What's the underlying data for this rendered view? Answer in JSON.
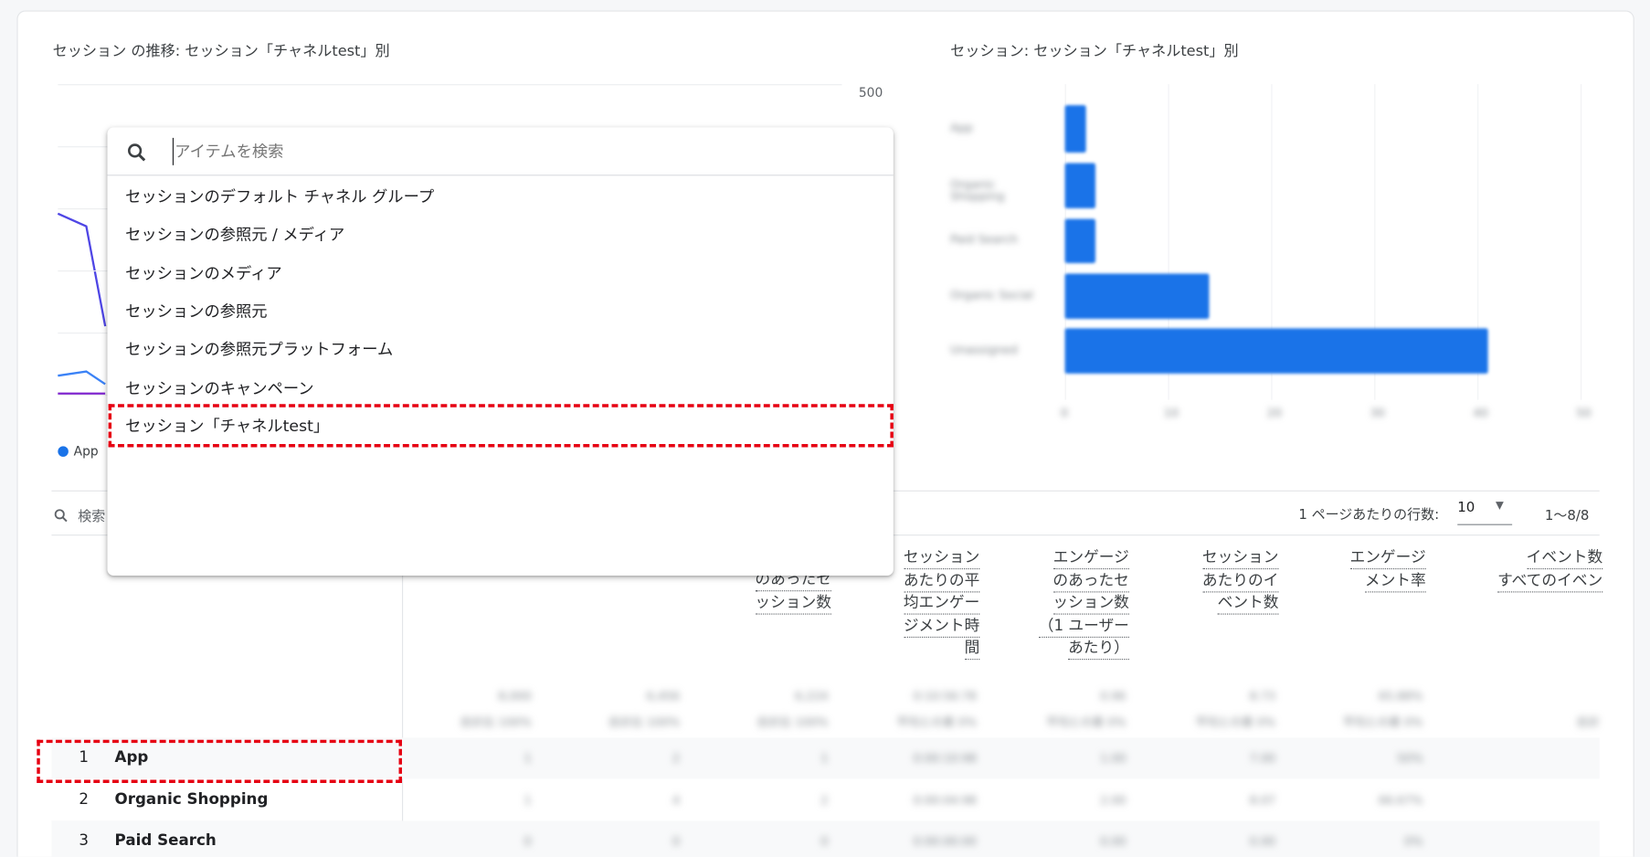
{
  "line_chart": {
    "title": "セッション の推移: セッション「チャネルtest」別",
    "y_tick_top": "500",
    "legend": [
      {
        "label": "App",
        "color": "#1a73e8"
      }
    ],
    "line_colors": [
      "#4f46e5",
      "#3b82f6",
      "#7e22ce"
    ]
  },
  "bar_chart": {
    "title": "セッション: セッション「チャネルtest」別",
    "bar_color": "#1a73e8"
  },
  "chart_data": {
    "type": "bar",
    "orientation": "horizontal",
    "title": "セッション: セッション「チャネルtest」別",
    "categories": [
      "App",
      "Organic Shopping",
      "Paid Search",
      "Organic Social",
      "Unassigned"
    ],
    "values": [
      2,
      3,
      3,
      14,
      41
    ],
    "x_ticks": [
      "0",
      "10",
      "20",
      "30",
      "40",
      "50"
    ],
    "xlim": [
      0,
      50
    ],
    "grid": true,
    "note_blurred": true
  },
  "dropdown": {
    "search_placeholder": "アイテムを検索",
    "search_icon": "search-icon",
    "items": [
      "セッションのデフォルト チャネル グループ",
      "セッションの参照元 / メディア",
      "セッションのメディア",
      "セッションの参照元",
      "セッションの参照元プラットフォーム",
      "セッションのキャンペーン",
      "セッション「チャネルtest」"
    ],
    "highlighted_index": 6,
    "highlight_color": "#e60012"
  },
  "table": {
    "search_label": "検索",
    "rows_per_page_label": "1 ページあたりの行数:",
    "rows_per_page_value": "10",
    "pagination": "1～8/8",
    "headers": [
      [],
      [],
      [
        "のあったセ",
        "ッション数"
      ],
      [
        "セッション",
        "あたりの平",
        "均エンゲー",
        "ジメント時",
        "間"
      ],
      [
        "エンゲージ",
        "のあったセ",
        "ッション数",
        "（1 ユーザー",
        "あたり）"
      ],
      [
        "セッション",
        "あたりのイ",
        "ベント数"
      ],
      [
        "エンゲージ",
        "メント率"
      ],
      [
        "イベント数",
        "すべてのイベン"
      ]
    ],
    "totals": [
      [
        "8,000",
        "合計比 100%"
      ],
      [
        "6,456",
        "合計比 100%"
      ],
      [
        "6,224",
        "合計比 100%"
      ],
      [
        "0:10:56:78",
        "平均との差 0%"
      ],
      [
        "0.96",
        "平均との差 0%"
      ],
      [
        "8.73",
        "平均との差 0%"
      ],
      [
        "65.88%",
        "平均との差 0%"
      ],
      [
        "",
        "合計"
      ]
    ],
    "rows": [
      {
        "rank": "1",
        "name": "App",
        "values": [
          "1",
          "2",
          "1",
          "0:00:10:98",
          "1.00",
          "7.00",
          "50%",
          ""
        ]
      },
      {
        "rank": "2",
        "name": "Organic Shopping",
        "values": [
          "1",
          "4",
          "2",
          "0:00:04:98",
          "2.00",
          "8.07",
          "66.67%",
          ""
        ]
      },
      {
        "rank": "3",
        "name": "Paid Search",
        "values": [
          "0",
          "0",
          "0",
          "0:00:00:00",
          "0.00",
          "0.00",
          "0%",
          ""
        ]
      }
    ],
    "highlighted_row": 0
  }
}
